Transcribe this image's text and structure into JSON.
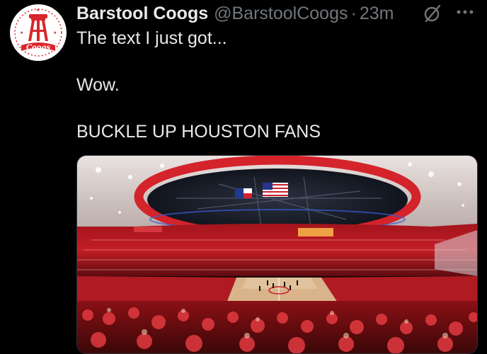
{
  "tweet": {
    "author_name": "Barstool Coogs",
    "handle": "@BarstoolCoogs",
    "separator": "·",
    "time": "23m",
    "lines": [
      "The text I just got...",
      "Wow.",
      "BUCKLE UP HOUSTON FANS"
    ],
    "avatar_text": "Coogs"
  },
  "icons": {
    "grok": "grok-icon",
    "more": "more-options-icon"
  },
  "colors": {
    "background": "#000000",
    "text": "#e7e9ea",
    "muted": "#71767b",
    "brand_red": "#d9262b"
  }
}
